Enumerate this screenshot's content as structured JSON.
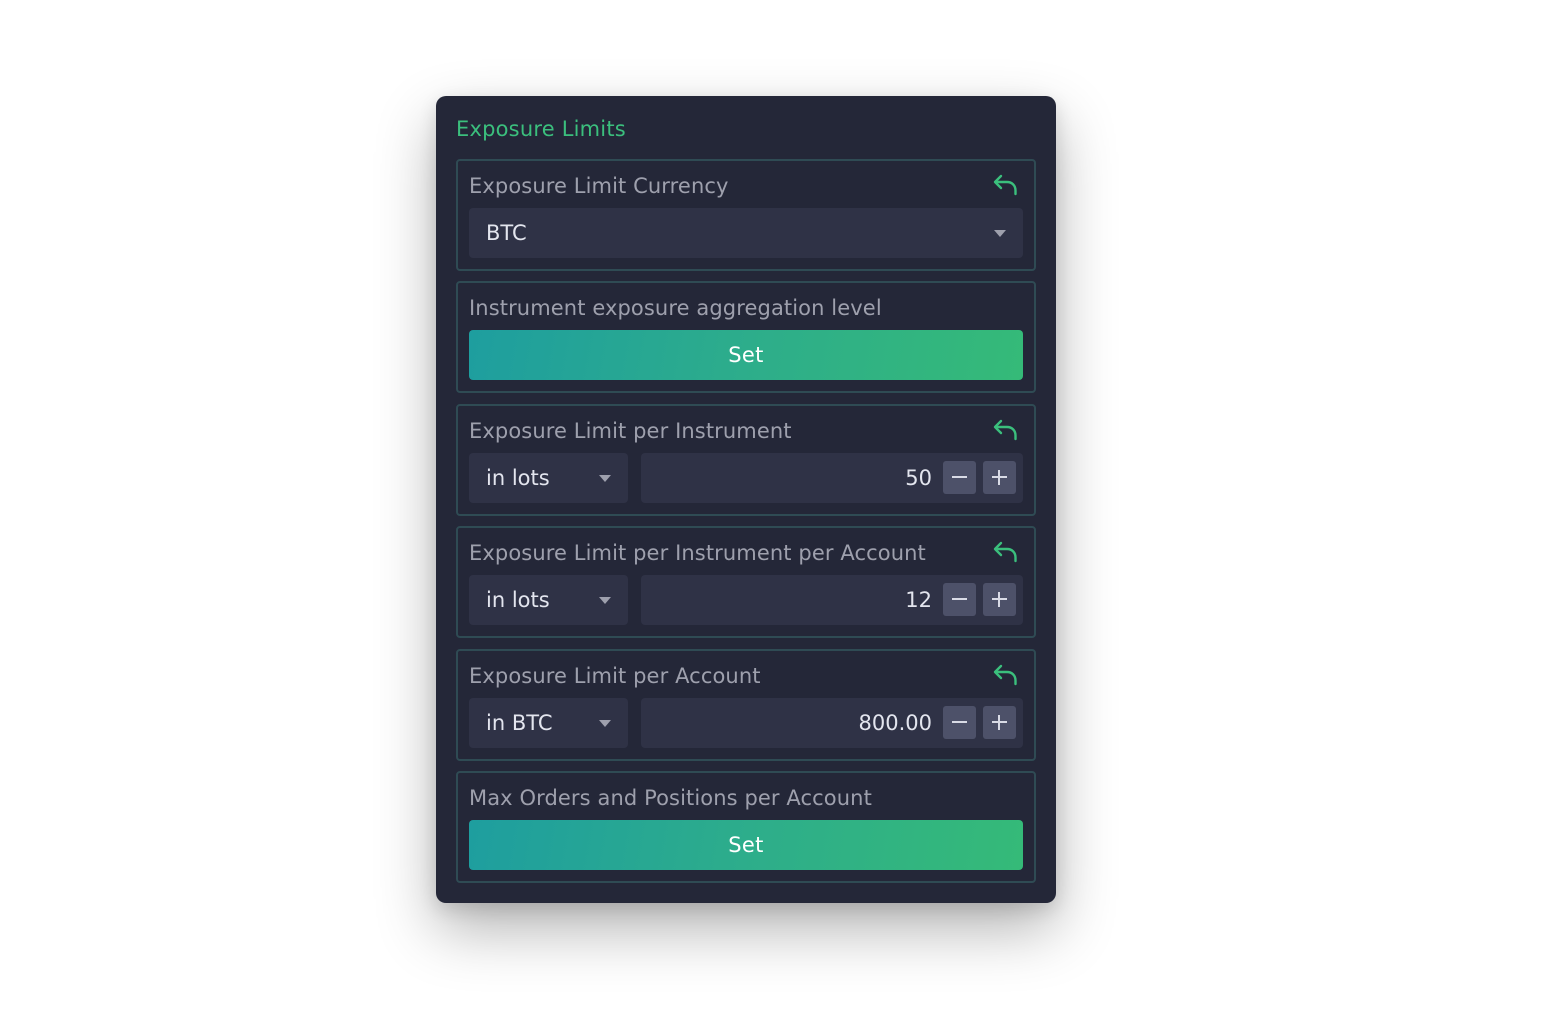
{
  "panel": {
    "title": "Exposure Limits"
  },
  "sections": {
    "currency": {
      "label": "Exposure Limit Currency",
      "value": "BTC",
      "reset_icon": "undo-arrow-icon"
    },
    "aggregation": {
      "label": "Instrument exposure aggregation level",
      "button_label": "Set"
    },
    "per_instrument": {
      "label": "Exposure Limit per Instrument",
      "unit": "in lots",
      "value": "50",
      "reset_icon": "undo-arrow-icon"
    },
    "per_instrument_account": {
      "label": "Exposure Limit per Instrument per Account",
      "unit": "in lots",
      "value": "12",
      "reset_icon": "undo-arrow-icon"
    },
    "per_account": {
      "label": "Exposure Limit per Account",
      "unit": "in BTC",
      "value": "800.00",
      "reset_icon": "undo-arrow-icon"
    },
    "max_orders": {
      "label": "Max Orders and Positions per Account",
      "button_label": "Set"
    }
  },
  "icons": {
    "stepper_minus": "minus-icon",
    "stepper_plus": "plus-icon",
    "dropdown": "chevron-down-icon"
  },
  "colors": {
    "panel_bg": "#242738",
    "accent_green": "#3bbf7d",
    "field_bg": "#2f3246",
    "section_border": "#2f4b54",
    "button_gradient_start": "#1e9e9f",
    "button_gradient_end": "#35ba78",
    "stepper_bg": "#4d5169"
  }
}
